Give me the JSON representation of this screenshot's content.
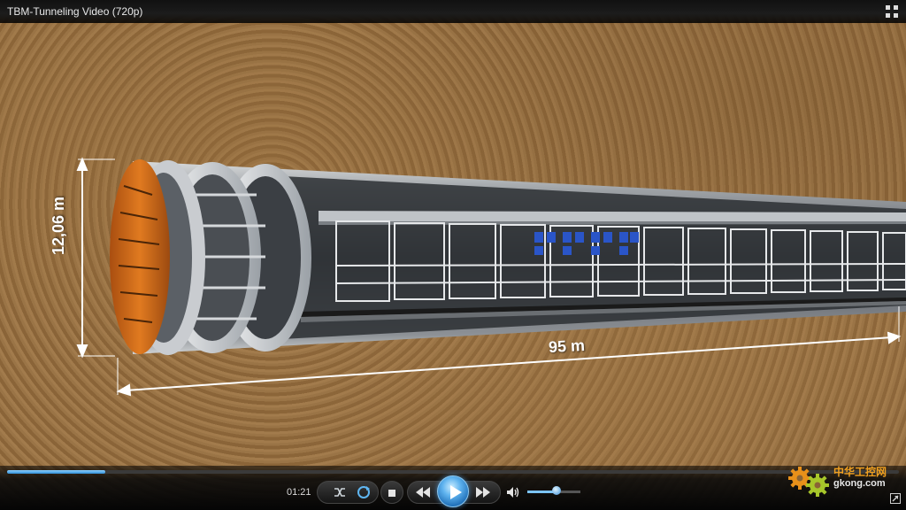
{
  "window": {
    "title": "TBM-Tunneling Video (720p)"
  },
  "video": {
    "dimension_height": "12,06 m",
    "dimension_length": "95 m"
  },
  "player": {
    "time": "01:21",
    "progress": 0.11,
    "volume": 0.55,
    "accent_color": "#2f8fd8"
  },
  "icons": {
    "fullscreen": "fullscreen-icon",
    "shuffle": "shuffle-icon",
    "repeat": "repeat-icon",
    "stop": "stop-icon",
    "previous": "previous-icon",
    "play": "play-icon",
    "next": "next-icon",
    "volume": "volume-icon",
    "resize": "resize-icon"
  },
  "watermark": {
    "cn_text": "中华工控网",
    "url": "gkong.com"
  }
}
